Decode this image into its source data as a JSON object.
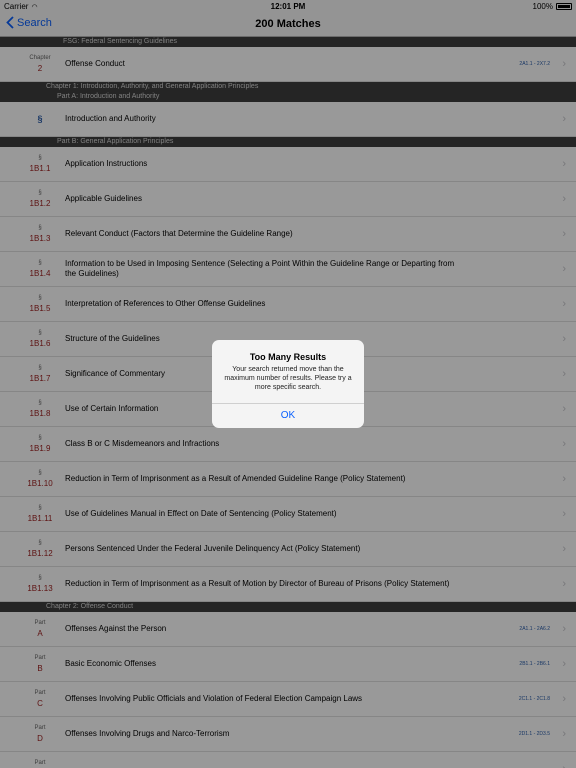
{
  "status": {
    "carrier": "Carrier",
    "time": "12:01 PM",
    "battery": "100%"
  },
  "nav": {
    "back": "Search",
    "title": "200 Matches"
  },
  "items": [
    {
      "type": "header",
      "level": 0,
      "text": "FSG: Federal Sentencing Guidelines"
    },
    {
      "type": "row",
      "label": "Chapter",
      "num": "2",
      "title": "Offense Conduct",
      "range": "2A1.1 - 2X7.2"
    },
    {
      "type": "header",
      "level": 1,
      "text": "Chapter 1: Introduction, Authority, and General Application Principles"
    },
    {
      "type": "header",
      "level": 2,
      "text": "Part A: Introduction and Authority"
    },
    {
      "type": "row",
      "label": "",
      "num": "§",
      "title": "Introduction and Authority",
      "range": "",
      "sec": true
    },
    {
      "type": "header",
      "level": 2,
      "text": "Part B: General Application Principles"
    },
    {
      "type": "row",
      "label": "§",
      "num": "1B1.1",
      "title": "Application Instructions",
      "range": ""
    },
    {
      "type": "row",
      "label": "§",
      "num": "1B1.2",
      "title": "Applicable Guidelines",
      "range": ""
    },
    {
      "type": "row",
      "label": "§",
      "num": "1B1.3",
      "title": "Relevant Conduct (Factors that Determine the Guideline Range)",
      "range": ""
    },
    {
      "type": "row",
      "label": "§",
      "num": "1B1.4",
      "title": "Information to be Used in Imposing Sentence (Selecting a Point Within the Guideline Range or Departing from the Guidelines)",
      "range": ""
    },
    {
      "type": "row",
      "label": "§",
      "num": "1B1.5",
      "title": "Interpretation of References to Other Offense Guidelines",
      "range": ""
    },
    {
      "type": "row",
      "label": "§",
      "num": "1B1.6",
      "title": "Structure of the Guidelines",
      "range": ""
    },
    {
      "type": "row",
      "label": "§",
      "num": "1B1.7",
      "title": "Significance of Commentary",
      "range": ""
    },
    {
      "type": "row",
      "label": "§",
      "num": "1B1.8",
      "title": "Use of Certain Information",
      "range": ""
    },
    {
      "type": "row",
      "label": "§",
      "num": "1B1.9",
      "title": "Class B or C Misdemeanors and Infractions",
      "range": ""
    },
    {
      "type": "row",
      "label": "§",
      "num": "1B1.10",
      "title": "Reduction in Term of Imprisonment as a Result of Amended Guideline Range (Policy Statement)",
      "range": ""
    },
    {
      "type": "row",
      "label": "§",
      "num": "1B1.11",
      "title": "Use of Guidelines Manual in Effect on Date of Sentencing (Policy Statement)",
      "range": ""
    },
    {
      "type": "row",
      "label": "§",
      "num": "1B1.12",
      "title": "Persons Sentenced Under the Federal Juvenile Delinquency Act (Policy Statement)",
      "range": ""
    },
    {
      "type": "row",
      "label": "§",
      "num": "1B1.13",
      "title": "Reduction in Term of Imprisonment as a Result of Motion by Director of Bureau of Prisons (Policy Statement)",
      "range": ""
    },
    {
      "type": "header",
      "level": 1,
      "text": "Chapter 2: Offense Conduct"
    },
    {
      "type": "row",
      "label": "Part",
      "num": "A",
      "title": "Offenses Against the Person",
      "range": "2A1.1 - 2A6.2"
    },
    {
      "type": "row",
      "label": "Part",
      "num": "B",
      "title": "Basic Economic Offenses",
      "range": "2B1.1 - 2B6.1"
    },
    {
      "type": "row",
      "label": "Part",
      "num": "C",
      "title": "Offenses Involving Public Officials and Violation of Federal Election Campaign Laws",
      "range": "2C1.1 - 2C1.8"
    },
    {
      "type": "row",
      "label": "Part",
      "num": "D",
      "title": "Offenses Involving Drugs and Narco-Terrorism",
      "range": "2D1.1 - 2D3.5"
    },
    {
      "type": "row",
      "label": "Part",
      "num": "",
      "title": "",
      "range": ""
    }
  ],
  "alert": {
    "title": "Too Many Results",
    "message": "Your search returned move than the maximum number of results. Please try a more specific search.",
    "button": "OK"
  },
  "colors": {
    "tint": "#0a60fe",
    "section_number": "#9b1c1c",
    "header_bg": "#3e3e3e"
  },
  "icons": {
    "back": "chevron-left-icon",
    "disclosure": "chevron-right-icon"
  }
}
